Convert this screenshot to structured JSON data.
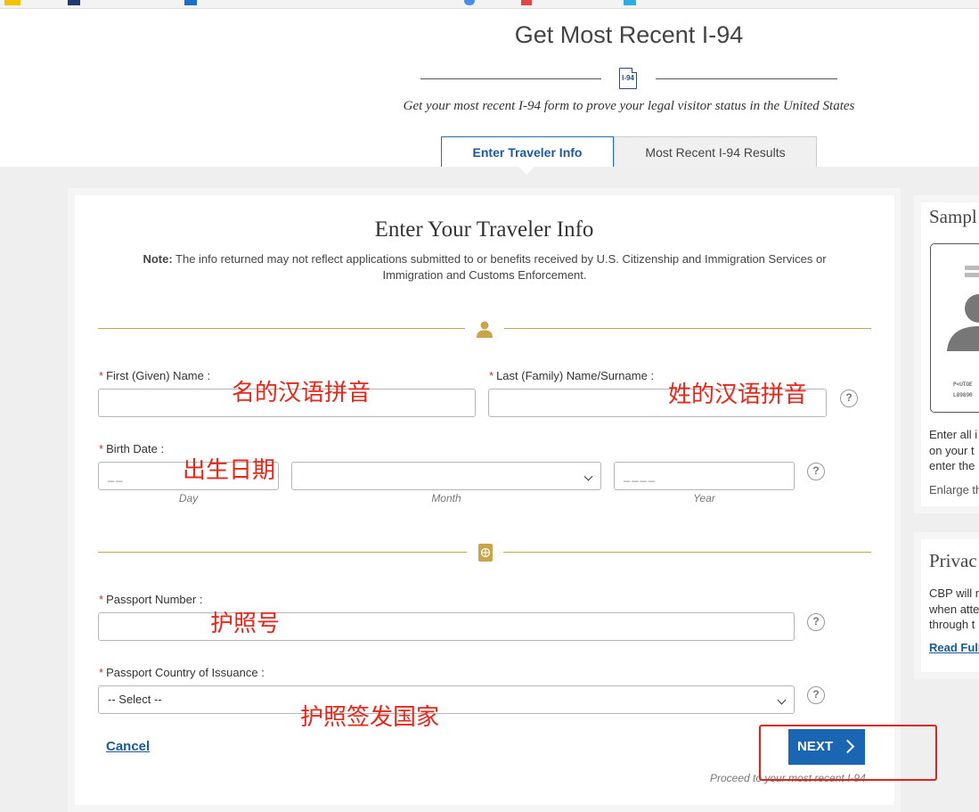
{
  "header": {
    "title": "Get Most Recent I-94",
    "doc_icon_text": "I-94",
    "subtitle": "Get your most recent I-94 form to prove your legal visitor status in the United States"
  },
  "tabs": [
    {
      "label": "Enter Traveler Info",
      "active": true
    },
    {
      "label": "Most Recent I-94 Results",
      "active": false
    }
  ],
  "form": {
    "title": "Enter Your Traveler Info",
    "note_label": "Note:",
    "note_text": " The info returned may not reflect applications submitted to or benefits received by U.S. Citizenship and Immigration Services or Immigration and Customs Enforcement.",
    "required_mark": "*",
    "first_name_label": "First (Given) Name :",
    "last_name_label": "Last (Family) Name/Surname :",
    "birth_date_label": "Birth Date :",
    "day_placeholder": "__",
    "year_placeholder": "____",
    "day_hint": "Day",
    "month_hint": "Month",
    "year_hint": "Year",
    "passport_number_label": "Passport Number :",
    "passport_country_label": "Passport Country of Issuance :",
    "country_select_value": "-- Select --",
    "help_glyph": "?",
    "cancel_label": "Cancel",
    "next_label": "NEXT",
    "proceed_text": "Proceed to your most recent I-94"
  },
  "annotations": {
    "first_name": "名的汉语拼音",
    "last_name": "姓的汉语拼音",
    "birth_date": "出生日期",
    "passport_number": "护照号",
    "passport_country": "护照签发国家"
  },
  "sidebar": {
    "sample_title": "Sampl",
    "passport_mrz_1": "P<UTOE",
    "passport_mrz_2": "L89890",
    "sample_lines": [
      "Enter all i",
      "on your t",
      "enter the"
    ],
    "enlarge_text": "Enlarge th",
    "privacy_title": "Privac",
    "privacy_lines": [
      "CBP will r",
      "when atte",
      "through t"
    ],
    "read_full_label": "Read Full"
  },
  "colors": {
    "accent_blue": "#1a66b3",
    "annotation_red": "#e8261a",
    "gold": "#c9a44a"
  }
}
